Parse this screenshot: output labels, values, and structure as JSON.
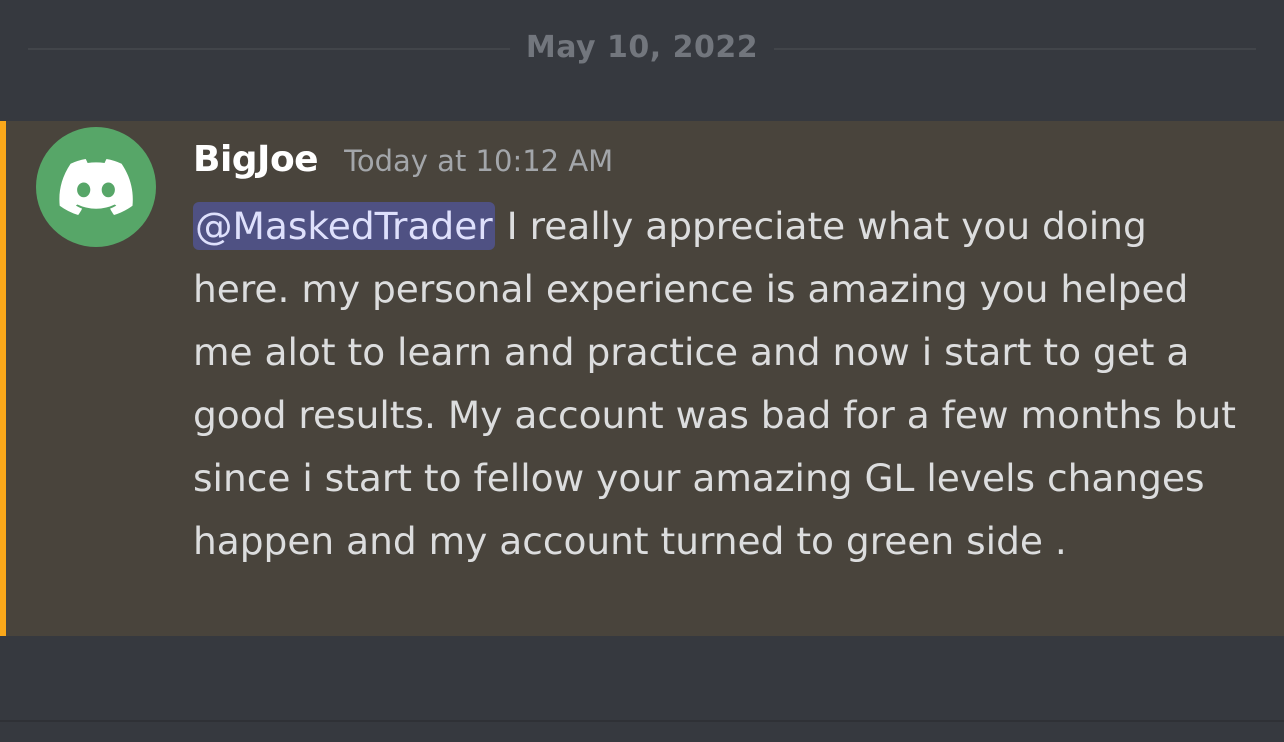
{
  "date_divider": {
    "label": "May 10, 2022"
  },
  "message": {
    "author": "BigJoe",
    "timestamp": "Today at 10:12 AM",
    "mention": "@MaskedTrader",
    "body": " I really appreciate what you doing here. my personal experience is amazing you helped me alot to learn and practice and now i start to get a good results.  My account was bad for a few months but since i start to fellow your amazing GL levels changes happen and my account turned to green side .",
    "avatar_icon": "discord-logo-icon",
    "avatar_color": "#57a668",
    "highlight_color": "#49443c",
    "mention_bar_color": "#faa81a"
  }
}
